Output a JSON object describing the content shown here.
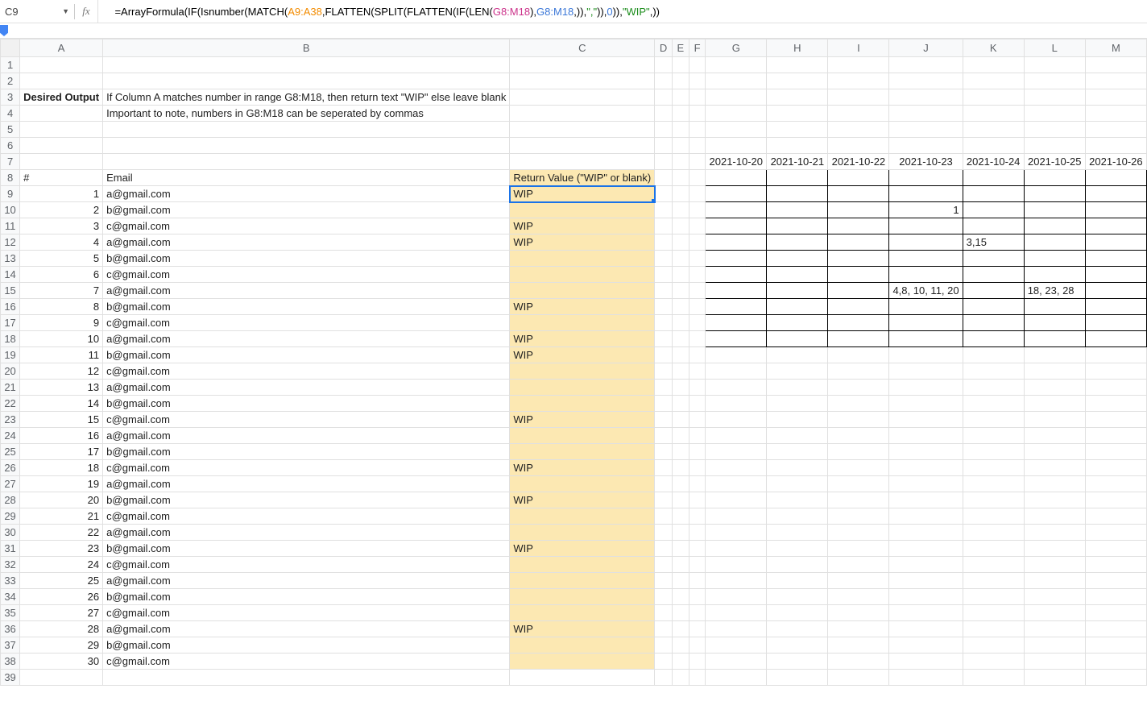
{
  "name_box": "C9",
  "formula_parts": {
    "prefix": "=ArrayFormula",
    "fn_if": "IF",
    "fn_isnum": "Isnumber",
    "fn_match": "MATCH",
    "fn_flatten": "FLATTEN",
    "fn_split": "SPLIT",
    "fn_len": "LEN",
    "range_a": "A9:A38",
    "range_g1": "G8:M18",
    "range_g2": "G8:M18",
    "comma_str": "\",\"",
    "zero": "0",
    "wip_str": "\"WIP\""
  },
  "formula_plain": "=ArrayFormula(IF(Isnumber(MATCH(A9:A38,FLATTEN(SPLIT(FLATTEN(IF(LEN(G8:M18),G8:M18,)),\",\")),0)),\"WIP\",))",
  "columns": [
    "A",
    "B",
    "C",
    "D",
    "E",
    "F",
    "G",
    "H",
    "I",
    "J",
    "K",
    "L",
    "M"
  ],
  "row_count": 39,
  "desired_output_label": "Desired Output",
  "note_line1": "If Column A matches number in range G8:M18, then return text \"WIP\" else leave blank",
  "note_line2": "Important to note, numbers in G8:M18 can be seperated by commas",
  "dates": [
    "2021-10-20",
    "2021-10-21",
    "2021-10-22",
    "2021-10-23",
    "2021-10-24",
    "2021-10-25",
    "2021-10-26"
  ],
  "headers": {
    "col_a": "#",
    "col_b": "Email",
    "col_c": "Return Value (\"WIP\" or blank)"
  },
  "data_rows": [
    {
      "n": 1,
      "email": "a@gmail.com",
      "ret": "WIP"
    },
    {
      "n": 2,
      "email": "b@gmail.com",
      "ret": ""
    },
    {
      "n": 3,
      "email": "c@gmail.com",
      "ret": "WIP"
    },
    {
      "n": 4,
      "email": "a@gmail.com",
      "ret": "WIP"
    },
    {
      "n": 5,
      "email": "b@gmail.com",
      "ret": ""
    },
    {
      "n": 6,
      "email": "c@gmail.com",
      "ret": ""
    },
    {
      "n": 7,
      "email": "a@gmail.com",
      "ret": ""
    },
    {
      "n": 8,
      "email": "b@gmail.com",
      "ret": "WIP"
    },
    {
      "n": 9,
      "email": "c@gmail.com",
      "ret": ""
    },
    {
      "n": 10,
      "email": "a@gmail.com",
      "ret": "WIP"
    },
    {
      "n": 11,
      "email": "b@gmail.com",
      "ret": "WIP"
    },
    {
      "n": 12,
      "email": "c@gmail.com",
      "ret": ""
    },
    {
      "n": 13,
      "email": "a@gmail.com",
      "ret": ""
    },
    {
      "n": 14,
      "email": "b@gmail.com",
      "ret": ""
    },
    {
      "n": 15,
      "email": "c@gmail.com",
      "ret": "WIP"
    },
    {
      "n": 16,
      "email": "a@gmail.com",
      "ret": ""
    },
    {
      "n": 17,
      "email": "b@gmail.com",
      "ret": ""
    },
    {
      "n": 18,
      "email": "c@gmail.com",
      "ret": "WIP"
    },
    {
      "n": 19,
      "email": "a@gmail.com",
      "ret": ""
    },
    {
      "n": 20,
      "email": "b@gmail.com",
      "ret": "WIP"
    },
    {
      "n": 21,
      "email": "c@gmail.com",
      "ret": ""
    },
    {
      "n": 22,
      "email": "a@gmail.com",
      "ret": ""
    },
    {
      "n": 23,
      "email": "b@gmail.com",
      "ret": "WIP"
    },
    {
      "n": 24,
      "email": "c@gmail.com",
      "ret": ""
    },
    {
      "n": 25,
      "email": "a@gmail.com",
      "ret": ""
    },
    {
      "n": 26,
      "email": "b@gmail.com",
      "ret": ""
    },
    {
      "n": 27,
      "email": "c@gmail.com",
      "ret": ""
    },
    {
      "n": 28,
      "email": "a@gmail.com",
      "ret": "WIP"
    },
    {
      "n": 29,
      "email": "b@gmail.com",
      "ret": ""
    },
    {
      "n": 30,
      "email": "c@gmail.com",
      "ret": ""
    }
  ],
  "grid_values": {
    "10": {
      "J": "1"
    },
    "12": {
      "K": "3,15"
    },
    "15": {
      "J": "4,8, 10, 11, 20",
      "L": "18, 23, 28"
    }
  }
}
